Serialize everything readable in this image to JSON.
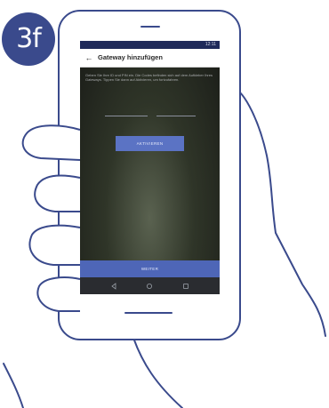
{
  "step": {
    "label": "3f"
  },
  "status": {
    "time": "12:11"
  },
  "appbar": {
    "back_icon": "arrow-left-icon",
    "title": "Gateway hinzufügen"
  },
  "content": {
    "instruction": "Geben Sie Ihre ID und PIN ein. Die Codes befinden sich auf dem Aufkleber Ihres Gateways. Tippen Sie dann auf Aktivieren, um fortzufahren.",
    "fields": [
      {
        "value": ""
      },
      {
        "value": ""
      }
    ],
    "activate_label": "AKTIVIEREN"
  },
  "footer": {
    "next_label": "WEITER"
  },
  "navbar": {
    "icons": [
      "back-triangle-icon",
      "home-circle-icon",
      "recents-square-icon"
    ]
  },
  "colors": {
    "brand": "#3a4a8c",
    "outline": "#3a4a8c",
    "button": "#5b73c4"
  }
}
